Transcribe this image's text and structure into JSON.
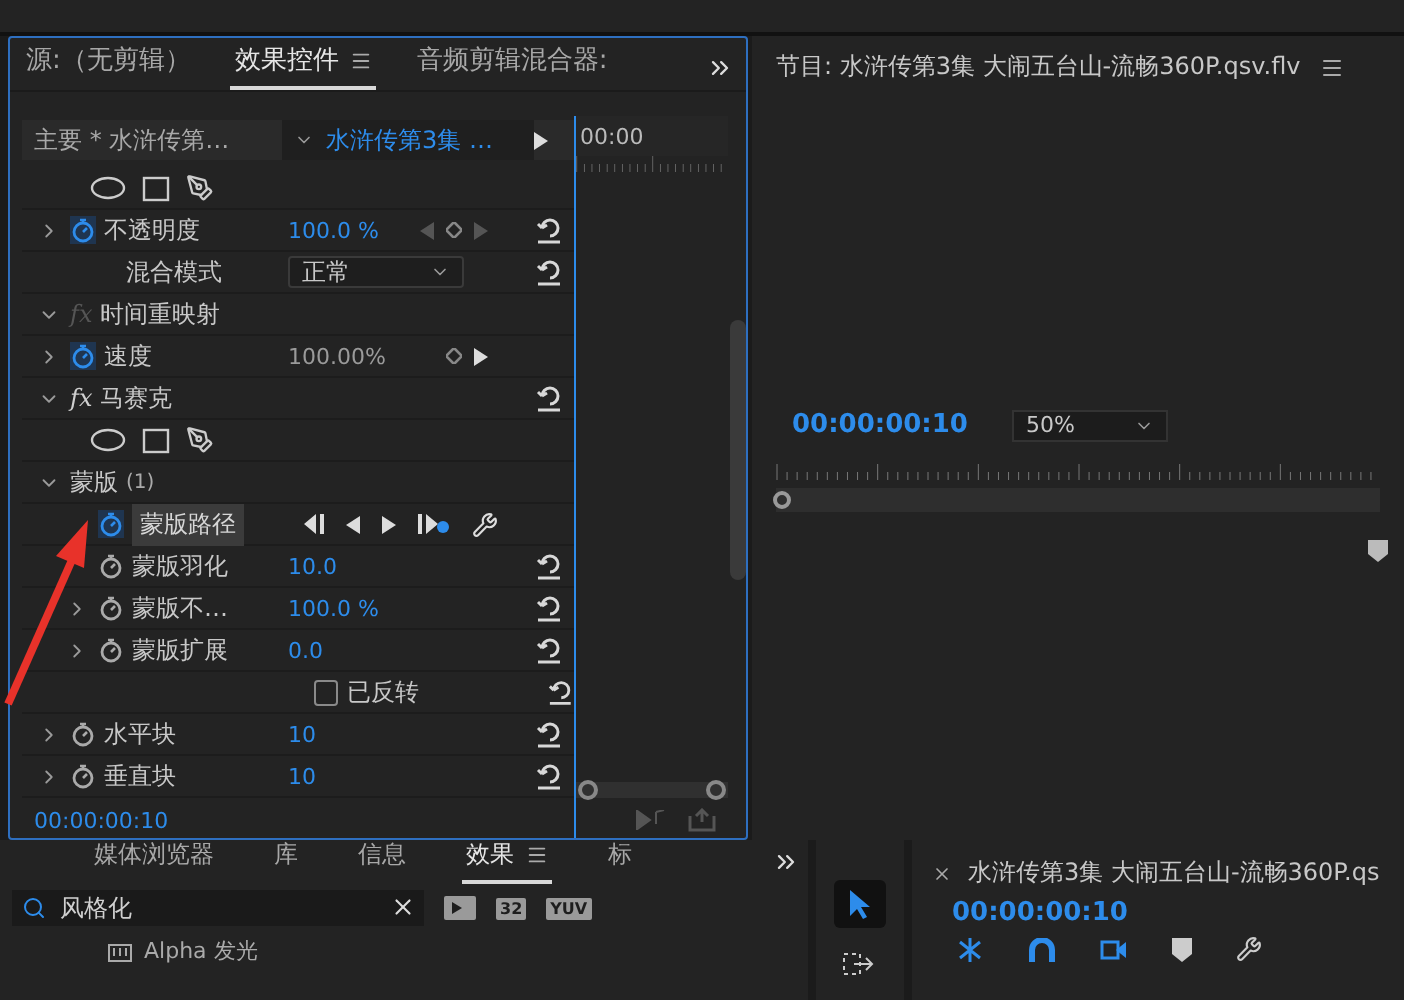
{
  "effect_controls": {
    "tabs": [
      {
        "label": "源:（无剪辑）",
        "selected": false,
        "menu": false
      },
      {
        "label": "效果控件",
        "selected": true,
        "menu": true
      },
      {
        "label": "音频剪辑混合器:",
        "selected": false,
        "menu": false
      }
    ],
    "master_clip": "主要 * 水浒传第…",
    "sequence_clip": "水浒传第3集 …",
    "ruler_time": "00:00",
    "tree": [
      {
        "kind": "group",
        "children": [
          {
            "kind": "shapes"
          },
          {
            "kind": "property",
            "label": "不透明度",
            "expanded": false,
            "animated": true,
            "value": "100.0 %",
            "value_disabled": false,
            "keyframe_nav": true,
            "prev_button": true,
            "reset": true
          },
          {
            "kind": "dropdown",
            "label": "混合模式",
            "value": "正常",
            "reset": true
          }
        ]
      },
      {
        "kind": "group",
        "badge": "fx",
        "badge_disabled": true,
        "label": "时间重映射",
        "expanded": true,
        "reset": false,
        "children": [
          {
            "kind": "property",
            "label": "速度",
            "expanded": false,
            "animated": true,
            "value": "100.00%",
            "value_disabled": true,
            "keyframe_nav": true,
            "prev_button": false,
            "reset": false
          }
        ]
      },
      {
        "kind": "group",
        "badge": "fx",
        "badge_disabled": false,
        "label": "马赛克",
        "expanded": true,
        "reset": true,
        "children": [
          {
            "kind": "shapes"
          },
          {
            "kind": "group",
            "label": "蒙版",
            "count": "(1)",
            "expanded": true,
            "reset": false,
            "children": [
              {
                "kind": "mask_path",
                "label": "蒙版路径",
                "animated": true,
                "selected": true
              },
              {
                "kind": "property",
                "label": "蒙版羽化",
                "animated": false,
                "value": "10.0",
                "value_disabled": false,
                "reset": true
              },
              {
                "kind": "property",
                "label": "蒙版不…",
                "expanded": false,
                "animated": false,
                "value": "100.0 %",
                "value_disabled": false,
                "reset": true
              },
              {
                "kind": "property",
                "label": "蒙版扩展",
                "expanded": false,
                "animated": false,
                "value": "0.0",
                "value_disabled": false,
                "reset": true
              },
              {
                "kind": "checkbox",
                "label": "已反转",
                "checked": false,
                "reset": true
              }
            ]
          },
          {
            "kind": "property",
            "label": "水平块",
            "expanded": false,
            "animated": false,
            "value": "10",
            "value_disabled": false,
            "reset": true
          },
          {
            "kind": "property",
            "label": "垂直块",
            "expanded": false,
            "animated": false,
            "value": "10",
            "value_disabled": false,
            "reset": true
          }
        ]
      }
    ],
    "timecode": "00:00:00:10"
  },
  "program_monitor": {
    "title": "节目: 水浒传第3集 大闹五台山-流畅360P.qsv.flv",
    "timecode": "00:00:00:10",
    "zoom": "50%"
  },
  "effects_panel": {
    "tabs": [
      {
        "label": "媒体浏览器",
        "selected": false,
        "menu": false
      },
      {
        "label": "库",
        "selected": false,
        "menu": false
      },
      {
        "label": "信息",
        "selected": false,
        "menu": false
      },
      {
        "label": "效果",
        "selected": true,
        "menu": true
      },
      {
        "label": "标",
        "selected": false,
        "menu": false
      }
    ],
    "search": {
      "value": "风格化"
    },
    "badges": [
      "32",
      "YUV"
    ],
    "items": [
      {
        "label": "Alpha 发光"
      }
    ]
  },
  "tools": [
    {
      "kind": "selection",
      "selected": true
    },
    {
      "kind": "track_select",
      "selected": false
    }
  ],
  "timeline": {
    "title": "水浒传第3集 大闹五台山-流畅360P.qs",
    "timecode": "00:00:00:10"
  },
  "annotation": {
    "kind": "arrow"
  }
}
